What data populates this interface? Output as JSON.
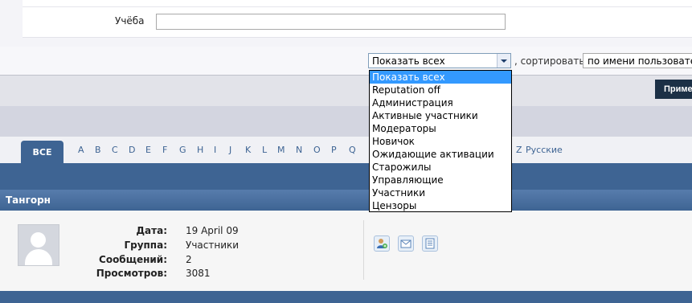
{
  "form": {
    "study_label": "Учёба",
    "study_value": ""
  },
  "filter": {
    "group_selected": "Показать всех",
    "sort_label": ", сортировать",
    "sort_selected": "по имени пользователя",
    "apply_label": "Приме"
  },
  "dropdown": {
    "options": [
      "Показать всех",
      "Reputation off",
      "Администрация",
      "Активные участники",
      "Модераторы",
      "Новичок",
      "Ожидающие активации",
      "Старожилы",
      "Управляющие",
      "Участники",
      "Цензоры"
    ],
    "highlighted_index": 0
  },
  "letters": {
    "all_tab": "ВСЕ",
    "items": [
      "A",
      "B",
      "C",
      "D",
      "E",
      "F",
      "G",
      "H",
      "I",
      "J",
      "K",
      "L",
      "M",
      "N",
      "O",
      "P",
      "Q",
      "Z",
      "Русские"
    ]
  },
  "member": {
    "name": "Тангорн",
    "fields": [
      {
        "key": "Дата:",
        "value": "19 April 09"
      },
      {
        "key": "Группа:",
        "value": "Участники"
      },
      {
        "key": "Сообщений:",
        "value": "2"
      },
      {
        "key": "Просмотров:",
        "value": "3081"
      }
    ],
    "actions": [
      "add-friend-icon",
      "send-message-icon",
      "view-posts-icon"
    ]
  },
  "colors": {
    "accent": "#3e6493",
    "highlight": "#3399ff"
  }
}
